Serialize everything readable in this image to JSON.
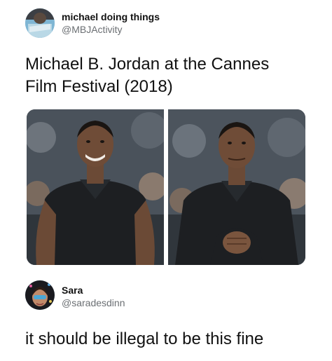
{
  "tweet": {
    "author_name": "michael doing things",
    "author_handle": "@MBJActivity",
    "text": "Michael B. Jordan at the Cannes Film Festival (2018)",
    "photos": [
      {
        "subject": "man smiling in black polo shirt"
      },
      {
        "subject": "man with clasped hands in black polo shirt"
      }
    ]
  },
  "reply": {
    "author_name": "Sara",
    "author_handle": "@saradesdinn",
    "text": "it should be illegal to be this fine"
  },
  "colors": {
    "text": "#111111",
    "handle": "#6b6f73",
    "background": "#ffffff"
  }
}
